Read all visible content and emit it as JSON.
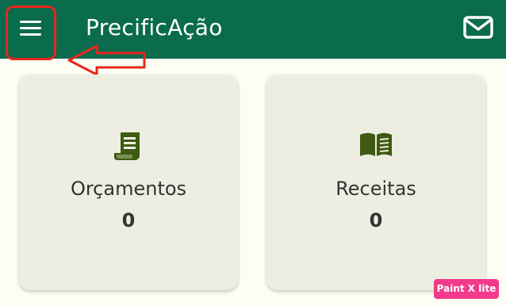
{
  "app_bar": {
    "title": "PrecificAção",
    "background": "#0A6B4D",
    "menu_icon": "menu-icon",
    "mail_icon": "mail-icon"
  },
  "annotation": {
    "highlight_color": "#E8271E",
    "arrow_direction": "left"
  },
  "cards": [
    {
      "label": "Orçamentos",
      "count": "0",
      "icon": "receipt-icon"
    },
    {
      "label": "Receitas",
      "count": "0",
      "icon": "book-icon"
    }
  ],
  "colors": {
    "page_background": "#FDFDF3",
    "card_background": "#EDEDE1",
    "icon_color": "#3F5A12"
  },
  "watermark": {
    "text": "Paint X lite"
  }
}
